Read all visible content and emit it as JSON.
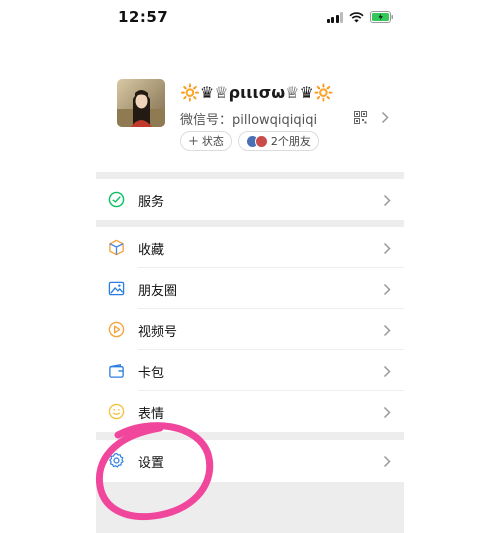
{
  "status_bar": {
    "time": "12:57"
  },
  "profile": {
    "nickname": "🔆♛♕ριιισω♕♛🔆",
    "wechat_id": "微信号：pillowqiqiqiqi",
    "status_chip": "状态",
    "friends_chip": "2个朋友"
  },
  "menu": {
    "service": "服务",
    "favorites": "收藏",
    "moments": "朋友圈",
    "channels": "视频号",
    "cards": "卡包",
    "stickers": "表情",
    "settings": "设置"
  },
  "colors": {
    "accent_green": "#07c160",
    "annotation_pink": "#f0479d",
    "background_gray": "#ededed"
  },
  "icons": [
    "signal-icon",
    "wifi-icon",
    "battery-icon",
    "qr-code-icon",
    "chevron-right-icon",
    "service-icon",
    "favorites-icon",
    "moments-icon",
    "channels-icon",
    "cards-icon",
    "stickers-icon",
    "settings-icon"
  ]
}
